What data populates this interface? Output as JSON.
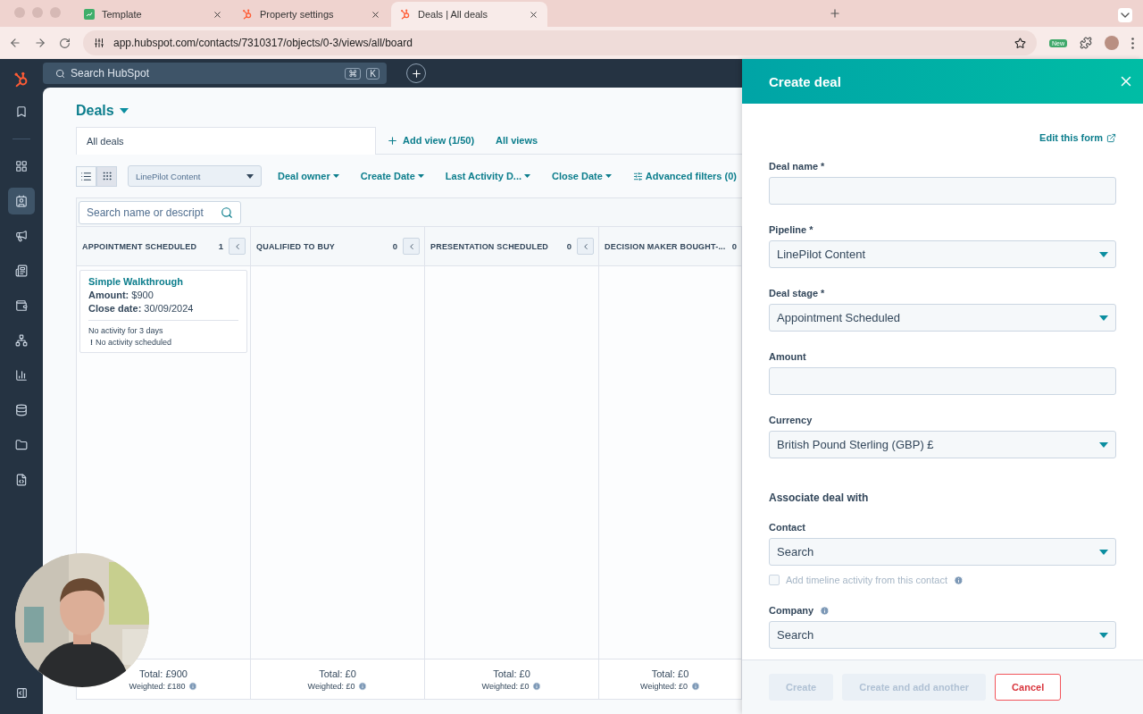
{
  "browser": {
    "tabs": [
      {
        "title": "Template",
        "selected": false
      },
      {
        "title": "Property settings",
        "selected": false
      },
      {
        "title": "Deals | All deals",
        "selected": true
      }
    ],
    "url": "app.hubspot.com/contacts/7310317/objects/0-3/views/all/board",
    "extension_badge": "New"
  },
  "topnav": {
    "search_placeholder": "Search HubSpot",
    "shortcut": [
      "⌘",
      "K"
    ]
  },
  "sidebar": {
    "items": [
      {
        "kind": "bookmark",
        "selected": false
      },
      {
        "kind": "grid",
        "selected": false
      },
      {
        "kind": "contacts",
        "selected": true
      },
      {
        "kind": "megaphone",
        "selected": false
      },
      {
        "kind": "document",
        "selected": false
      },
      {
        "kind": "wallet",
        "selected": false
      },
      {
        "kind": "network",
        "selected": false
      },
      {
        "kind": "chart",
        "selected": false
      },
      {
        "kind": "database",
        "selected": false
      },
      {
        "kind": "folder",
        "selected": false
      },
      {
        "kind": "code",
        "selected": false
      }
    ]
  },
  "page": {
    "title": "Deals",
    "views": [
      {
        "label": "All deals",
        "selected": true
      }
    ],
    "add_view": "Add view (1/50)",
    "all_views": "All views"
  },
  "toolbar": {
    "layouts": [
      {
        "kind": "list",
        "selected": false
      },
      {
        "kind": "board",
        "selected": true
      }
    ],
    "pipeline": "LinePilot Content",
    "filters": [
      "Deal owner",
      "Create Date",
      "Last Activity D...",
      "Close Date"
    ],
    "advanced_filters": "Advanced filters (0)"
  },
  "board": {
    "search_placeholder": "Search name or descript",
    "columns": [
      {
        "name": "APPOINTMENT SCHEDULED",
        "count": "1",
        "collapse_button": true,
        "cards": [
          {
            "title": "Simple Walkthrough",
            "lines": [
              "**Amount:** $900",
              "**Close date:** 30/09/2024"
            ],
            "activity": "No activity for 3 days",
            "alert": "!",
            "alert_text": "No activity scheduled"
          }
        ],
        "total": "Total: £900",
        "weighted": "Weighted: £180"
      },
      {
        "name": "QUALIFIED TO BUY",
        "count": "0",
        "collapse_button": true,
        "total": "Total: £0",
        "weighted": "Weighted: £0"
      },
      {
        "name": "PRESENTATION SCHEDULED",
        "count": "0",
        "collapse_button": true,
        "total": "Total: £0",
        "weighted": "Weighted: £0"
      },
      {
        "name": "DECISION MAKER BOUGHT-...",
        "count": "0",
        "collapse_button": false,
        "total": "Total: £0",
        "weighted": "Weighted: £0"
      }
    ]
  },
  "create_deal": {
    "title": "Create deal",
    "edit_link": "Edit this form",
    "fields": [
      {
        "kind": "text",
        "label": "Deal name *"
      },
      {
        "kind": "select",
        "label": "Pipeline *",
        "value": "LinePilot Content"
      },
      {
        "kind": "select",
        "label": "Deal stage *",
        "value": "Appointment Scheduled"
      },
      {
        "kind": "text",
        "label": "Amount"
      },
      {
        "kind": "select",
        "label": "Currency",
        "value": "British Pound Sterling (GBP) £"
      }
    ],
    "association_heading": "Associate deal with",
    "associations": [
      {
        "kind": "select",
        "label": "Contact",
        "value": "Search"
      },
      {
        "kind": "checkbox",
        "label": "Add timeline activity from this contact",
        "checked": false,
        "info": true
      },
      {
        "kind": "select",
        "label": "Company",
        "value": "Search",
        "info": true
      }
    ],
    "buttons": [
      {
        "label": "Create",
        "kind": "primary",
        "disabled": true
      },
      {
        "label": "Create and add another",
        "kind": "secondary",
        "disabled": true
      },
      {
        "label": "Cancel",
        "kind": "danger",
        "disabled": false
      }
    ]
  }
}
